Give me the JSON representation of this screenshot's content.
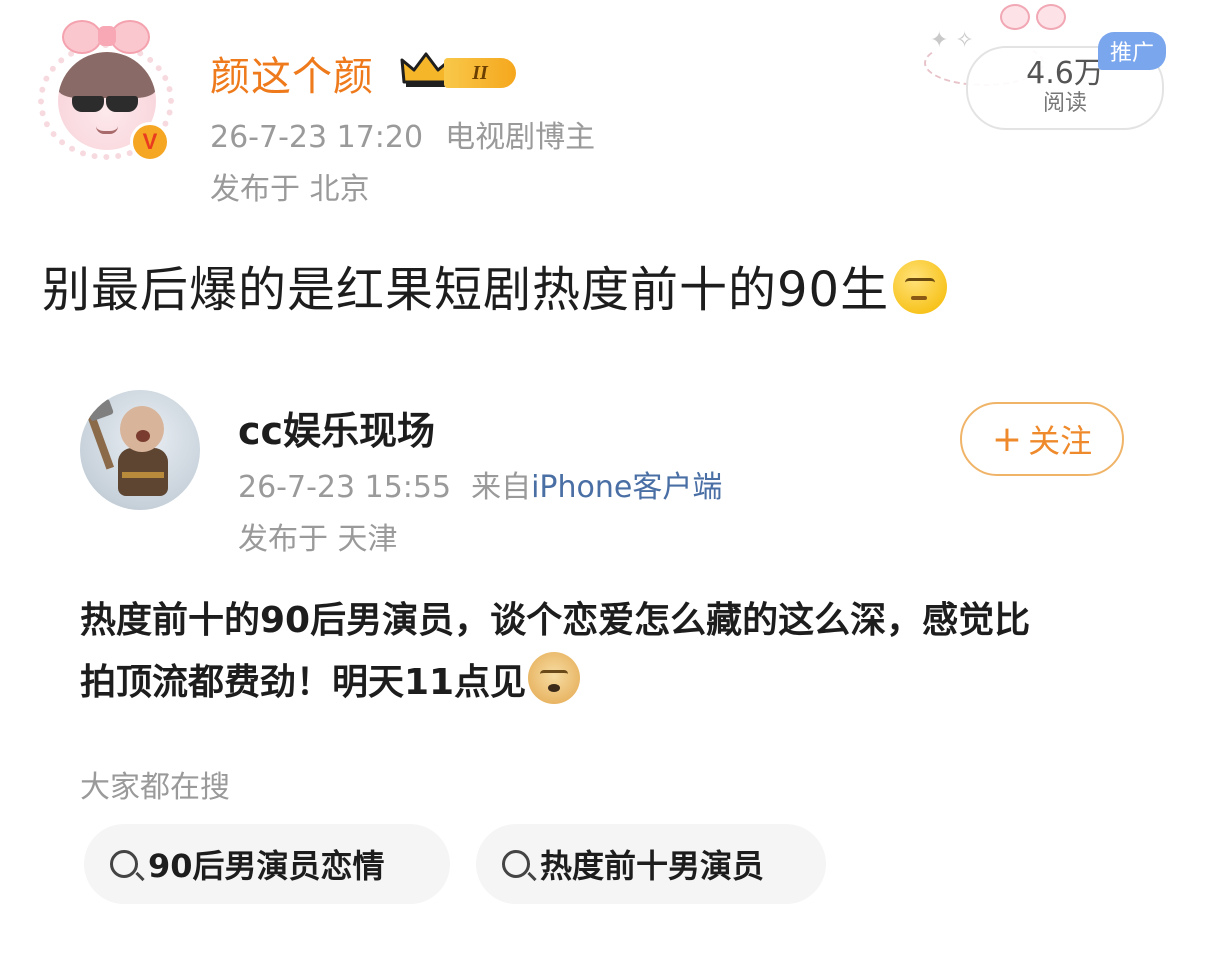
{
  "author": {
    "name": "颜这个颜",
    "level_badge": "II",
    "date": "26-7-23 17:20",
    "role": "电视剧博主",
    "location": "发布于 北京"
  },
  "stats": {
    "read_count": "4.6万",
    "read_label": "阅读",
    "promo_tag": "推广"
  },
  "post": {
    "text": "别最后爆的是红果短剧热度前十的90生",
    "emoji": "thinking-face-icon"
  },
  "quoted": {
    "name": "cc娱乐现场",
    "follow_label": "关注",
    "follow_plus": "+",
    "date": "26-7-23 15:55",
    "source_prefix": "来自",
    "source": "iPhone客户端",
    "location": "发布于 天津",
    "text": "热度前十的90后男演员，谈个恋爱怎么藏的这么深，感觉比拍顶流都费劲！明天11点见",
    "emoji": "doge-icon",
    "search_label": "大家都在搜",
    "search_chips": [
      {
        "label": "90后男演员恋情"
      },
      {
        "label": "热度前十男演员"
      }
    ]
  },
  "colors": {
    "author_name": "#ee7a1c",
    "follow": "#ef8a2c",
    "promo": "#7aa6ee",
    "meta": "#9a9a9a"
  }
}
